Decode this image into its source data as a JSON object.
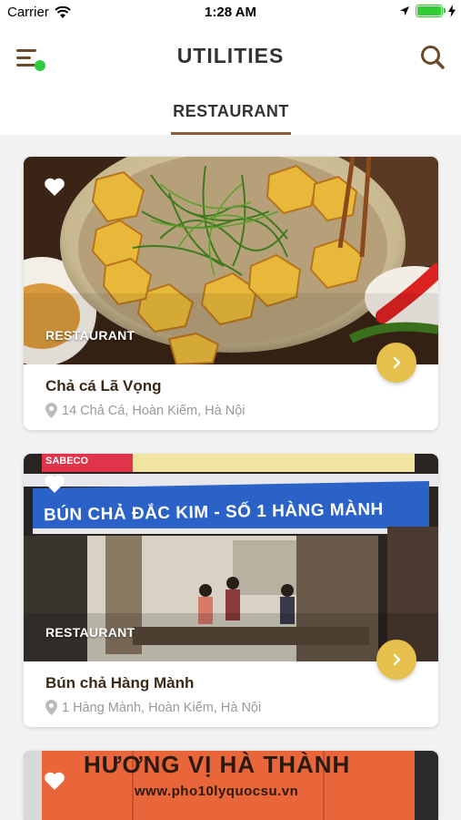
{
  "status_bar": {
    "carrier": "Carrier",
    "time": "1:28 AM"
  },
  "header": {
    "title": "UTILITIES"
  },
  "tabs": [
    {
      "label": "RESTAURANT"
    }
  ],
  "restaurants": [
    {
      "category": "RESTAURANT",
      "name": "Chả cá Lã Vọng",
      "address": "14 Chả Cá, Hoàn Kiếm, Hà Nội"
    },
    {
      "category": "RESTAURANT",
      "name": "Bún chả Hàng Mành",
      "address": "1 Hàng Mành, Hoàn Kiếm, Hà Nội",
      "sign_text": "BÚN CHẢ ĐẮC KIM - SỐ 1 HÀNG MÀNH",
      "banner_text": "SABECO"
    },
    {
      "sign_text": "HƯƠNG VỊ HÀ THÀNH",
      "sign_subtext": "www.pho10lyquocsu.vn"
    }
  ],
  "colors": {
    "accent": "#e6c04c",
    "brand_brown": "#8b5e34",
    "online_dot": "#2ecc40"
  }
}
